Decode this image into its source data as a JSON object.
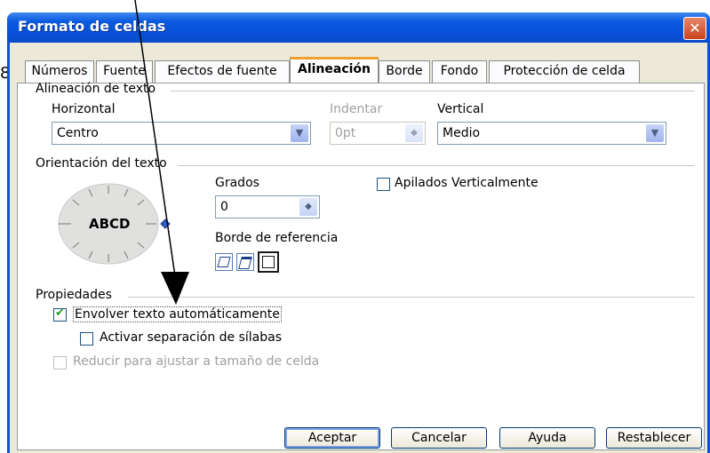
{
  "window": {
    "title": "Formato de celdas",
    "close_label": "✕"
  },
  "tabs": [
    {
      "label": "Números",
      "active": false
    },
    {
      "label": "Fuente",
      "active": false
    },
    {
      "label": "Efectos de fuente",
      "active": false
    },
    {
      "label": "Alineación",
      "active": true
    },
    {
      "label": "Borde",
      "active": false
    },
    {
      "label": "Fondo",
      "active": false
    },
    {
      "label": "Protección de celda",
      "active": false
    }
  ],
  "alignment": {
    "section_title": "Alineación de texto",
    "horizontal_label": "Horizontal",
    "horizontal_value": "Centro",
    "indent_label": "Indentar",
    "indent_value": "0pt",
    "vertical_label": "Vertical",
    "vertical_value": "Medio"
  },
  "orientation": {
    "section_title": "Orientación del texto",
    "dial_text": "ABCD",
    "degrees_label": "Grados",
    "degrees_value": "0",
    "reference_label": "Borde de referencia",
    "stacked_label": "Apilados Verticalmente"
  },
  "properties": {
    "section_title": "Propiedades",
    "wrap_label": "Envolver texto automáticamente",
    "wrap_checked": true,
    "hyphen_label": "Activar separación de sílabas",
    "hyphen_checked": false,
    "shrink_label": "Reducir para ajustar a tamaño de celda",
    "shrink_checked": false
  },
  "buttons": {
    "ok": "Aceptar",
    "cancel": "Cancelar",
    "help": "Ayuda",
    "reset": "Restablecer"
  },
  "stray_glyph": "8"
}
